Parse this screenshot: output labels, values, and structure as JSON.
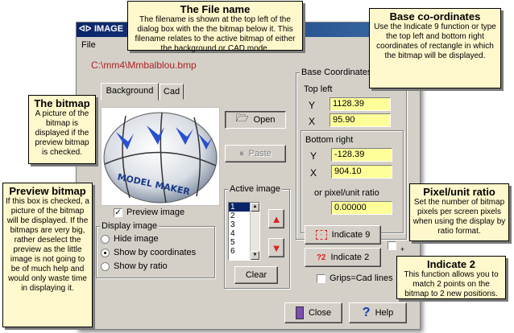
{
  "window": {
    "title": "IMAGE"
  },
  "menu": {
    "file": "File"
  },
  "filename": "C:\\mm4\\Mmbalblou.bmp",
  "tabs": {
    "background": "Background",
    "cad": "Cad"
  },
  "preview": {
    "ball_text": "MODEL MAKER"
  },
  "checkboxes": {
    "preview_image": "Preview image",
    "grips_cad": "Grips=Cad lines"
  },
  "display_image": {
    "legend": "Display image",
    "options": [
      "Hide image",
      "Show by coordinates",
      "Show by ratio"
    ],
    "selected": "Show by coordinates"
  },
  "buttons": {
    "open": "Open",
    "paste": "Paste",
    "clear": "Clear",
    "indicate9": "Indicate 9",
    "indicate2": "Indicate 2",
    "close": "Close",
    "help": "Help"
  },
  "active_image": {
    "legend": "Active image",
    "items": [
      "1",
      "2",
      "3",
      "4",
      "5",
      "6"
    ],
    "selected": "1"
  },
  "base_coordinates": {
    "legend": "Base Coordinates",
    "top_left": "Top left",
    "bottom_right": "Bottom right",
    "y_label": "Y",
    "x_label": "X",
    "top_left_y": "1128.39",
    "top_left_x": "95.90",
    "bottom_right_y": "-128.39",
    "bottom_right_x": "904.10",
    "ratio_label": "or pixel/unit ratio",
    "ratio": "0.00000"
  },
  "plus_label": "+",
  "callouts": {
    "file_name": {
      "title": "The File name",
      "body": "The filename is shown at the top left of the dialog box with the the  bitmap below it. This filename relates to the active bitmap of either the background or CAD mode."
    },
    "base_coords": {
      "title": "Base co-ordinates",
      "body": "Use the Indicate 9 function or type the top left and bottom right coordinates of rectangle in which the bitmap will be displayed."
    },
    "bitmap": {
      "title": "The bitmap",
      "body": "A picture of the bitmap is displayed if the preview bitmap is checked."
    },
    "preview_bitmap": {
      "title": "Preview bitmap",
      "body": "If this box is checked, a picture of the bitmap will be displayed. If the bitmaps are very big, rather deselect the preview as the little image is not going to be of much help and would only waste time in displaying it."
    },
    "pixel_unit": {
      "title": "Pixel/unit ratio",
      "body": "Set the number of bitmap pixels per screen pixels when using the display by ratio format."
    },
    "indicate2": {
      "title": "Indicate 2",
      "body": "This function allows you to match 2 points on the bitmap to 2 new positions."
    }
  },
  "colors": {
    "title_bar": "#0a246a",
    "filename_text": "#b02020",
    "field_bg": "#ffff99",
    "callout_bg": "#fff8cc",
    "arrow_red": "#e02020"
  }
}
